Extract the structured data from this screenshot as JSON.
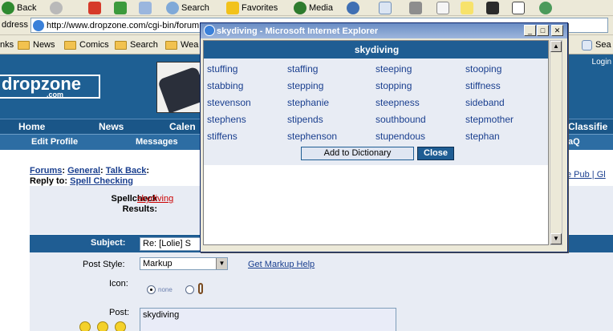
{
  "browser": {
    "toolbar": {
      "back": "Back",
      "search": "Search",
      "favorites": "Favorites",
      "media": "Media"
    },
    "address": {
      "label": "ddress",
      "url": "http://www.dropzone.com/cgi-bin/forum"
    },
    "links": {
      "prefix": "nks",
      "items": [
        "News",
        "Comics",
        "Search",
        "Wea"
      ],
      "right_search": "Sea"
    }
  },
  "page": {
    "logo": "dropzone",
    "logo_sub": ".com",
    "login": "Login",
    "nav_primary": [
      "Home",
      "News",
      "Calen",
      "Classifie"
    ],
    "nav_secondary": [
      "Edit Profile",
      "Messages",
      "aQ"
    ],
    "breadcrumb": {
      "forums": "Forums",
      "general": "General",
      "talkback": "Talk Back",
      "reply_prefix": "Reply to:",
      "reply_topic": "Spell Checking"
    },
    "right_links": "e Pub | Gl",
    "spellcheck": {
      "label_line1": "Spellcheck",
      "label_line2": "Results:",
      "word": "skydiving"
    },
    "subject": {
      "label": "Subject:",
      "value": "Re: [Lolie] S"
    },
    "post_style": {
      "label": "Post Style:",
      "selected": "Markup",
      "help_link": "Get Markup Help"
    },
    "icon": {
      "label": "Icon:",
      "none": "none"
    },
    "post": {
      "label": "Post:",
      "value": "skydiving"
    }
  },
  "popup": {
    "title": "skydiving - Microsoft Internet Explorer",
    "heading": "skydiving",
    "suggestions": [
      [
        "stuffing",
        "staffing",
        "steeping",
        "stooping"
      ],
      [
        "stabbing",
        "stepping",
        "stopping",
        "stiffness"
      ],
      [
        "stevenson",
        "stephanie",
        "steepness",
        "sideband"
      ],
      [
        "stephens",
        "stipends",
        "southbound",
        "stepmother"
      ],
      [
        "stiffens",
        "stephenson",
        "stupendous",
        "stephan"
      ]
    ],
    "add_button": "Add to Dictionary",
    "close_button": "Close"
  }
}
